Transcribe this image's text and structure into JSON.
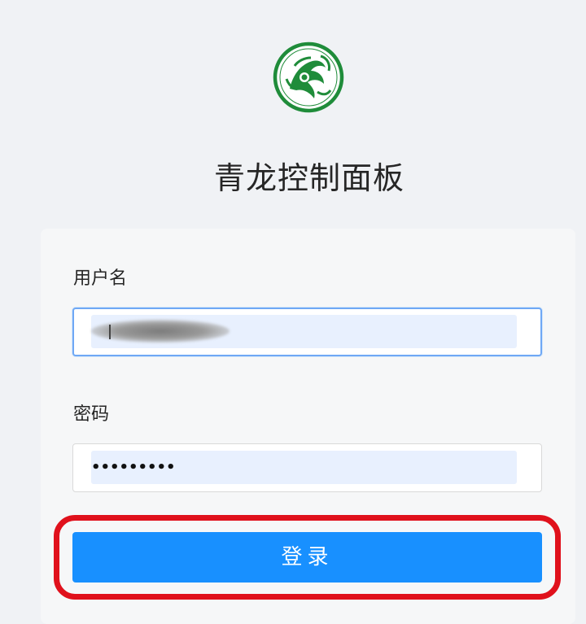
{
  "app": {
    "title": "青龙控制面板",
    "logo_icon": "dragon-logo-icon",
    "accent_color": "#1890ff",
    "logo_color": "#1f8c3a"
  },
  "login_form": {
    "username_label": "用户名",
    "username_value": "",
    "password_label": "密码",
    "password_value": "•••••••••",
    "submit_label": "登录"
  },
  "annotation": {
    "highlight_color": "#e0111c"
  }
}
